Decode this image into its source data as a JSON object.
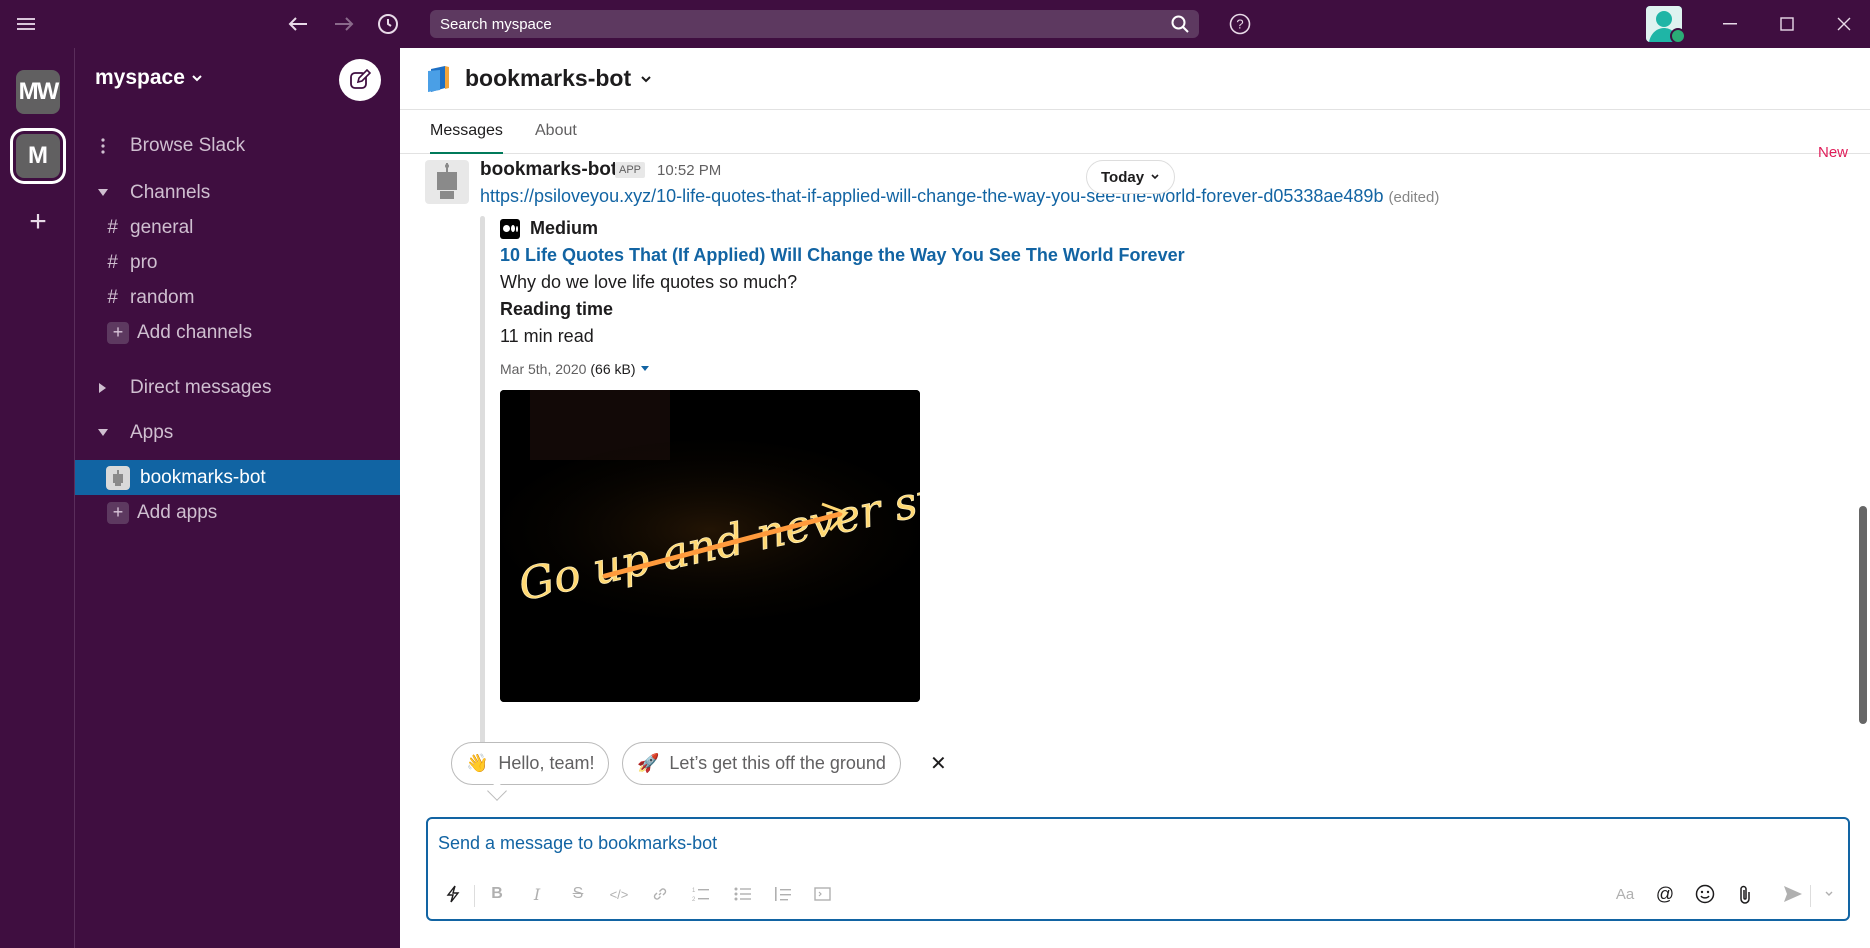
{
  "topbar": {
    "search_placeholder": "Search myspace",
    "icons": [
      "menu-icon",
      "back-arrow-icon",
      "forward-arrow-icon",
      "history-icon",
      "search-icon",
      "help-icon",
      "minimize-icon",
      "maximize-icon",
      "close-icon"
    ]
  },
  "rail": {
    "workspaces": [
      {
        "label": "MW"
      },
      {
        "label": "M"
      }
    ],
    "add_label": "+"
  },
  "sidebar": {
    "workspace_name": "myspace",
    "browse": "Browse Slack",
    "channels_header": "Channels",
    "channels": [
      {
        "prefix": "#",
        "label": "general"
      },
      {
        "prefix": "#",
        "label": "pro"
      },
      {
        "prefix": "#",
        "label": "random"
      }
    ],
    "add_channels": "Add channels",
    "dms_header": "Direct messages",
    "apps_header": "Apps",
    "apps": [
      {
        "label": "bookmarks-bot",
        "active": true
      }
    ],
    "add_apps": "Add apps"
  },
  "channel": {
    "title": "bookmarks-bot",
    "tabs": [
      "Messages",
      "About"
    ]
  },
  "message": {
    "author": "bookmarks-bot",
    "badge": "APP",
    "time": "10:52 PM",
    "date_divider": "Today",
    "new_label": "New",
    "link": "https://psiloveyou.xyz/10-life-quotes-that-if-applied-will-change-the-way-you-see-the-world-forever-d05338ae489b",
    "edited": "(edited)",
    "unfurl": {
      "service": "Medium",
      "title": "10 Life Quotes That (If Applied) Will Change the Way You See The World Forever",
      "description": "Why do we love life quotes so much?",
      "field_title": "Reading time",
      "field_value": "11 min read",
      "image_date": "Mar 5th, 2020",
      "image_size": "(66 kB)",
      "image_text": "Go up and never stop"
    }
  },
  "suggestions": [
    {
      "emoji": "👋",
      "label": "Hello, team!"
    },
    {
      "emoji": "🚀",
      "label": "Let’s get this off the ground"
    }
  ],
  "composer": {
    "placeholder": "Send a message to bookmarks-bot",
    "aa_label": "Aa",
    "at_label": "@"
  },
  "colors": {
    "aubergine": "#3f0e40",
    "active_blue": "#1164a3",
    "link_blue": "#1264a3",
    "new_red": "#e01e5a"
  }
}
